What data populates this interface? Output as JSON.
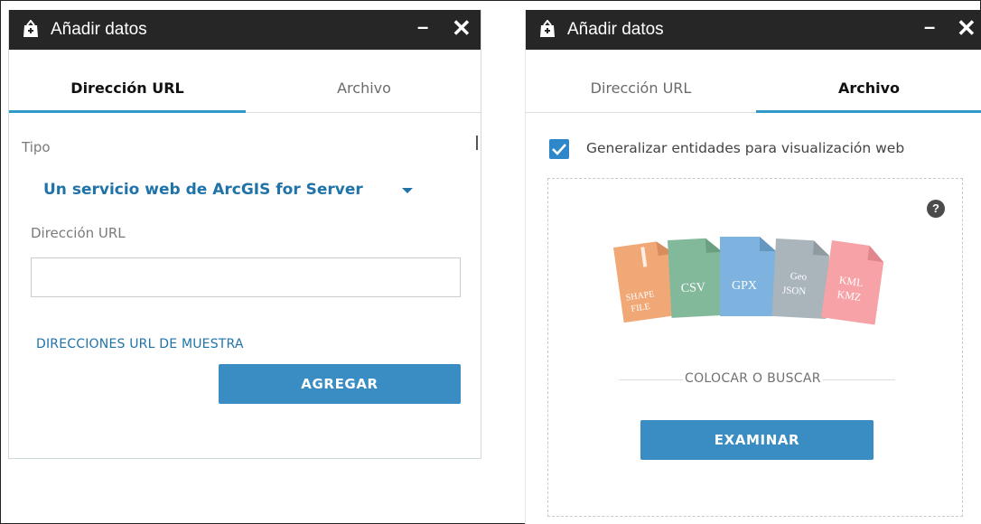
{
  "left_panel": {
    "title": "Añadir datos",
    "minimize_glyph": "–",
    "close_glyph": "✕",
    "tabs": [
      {
        "label": "Dirección URL",
        "active": true
      },
      {
        "label": "Archivo",
        "active": false
      }
    ],
    "type_label": "Tipo",
    "type_value": "Un servicio web de ArcGIS for Server",
    "url_label": "Dirección URL",
    "url_value": "",
    "sample_link": "DIRECCIONES URL DE MUESTRA",
    "add_button": "AGREGAR"
  },
  "right_panel": {
    "title": "Añadir datos",
    "minimize_glyph": "–",
    "close_glyph": "✕",
    "tabs": [
      {
        "label": "Dirección URL",
        "active": false
      },
      {
        "label": "Archivo",
        "active": true
      }
    ],
    "generalize_label": "Generalizar entidades para visualización web",
    "generalize_checked": true,
    "help_glyph": "?",
    "file_types": [
      {
        "lines": [
          "SHAPE",
          "FILE"
        ],
        "color": "#f0a877",
        "icon": "zipper-icon"
      },
      {
        "lines": [
          "CSV"
        ],
        "color": "#82b99a"
      },
      {
        "lines": [
          "GPX"
        ],
        "color": "#7db3de"
      },
      {
        "lines": [
          "Geo",
          "JSON"
        ],
        "color": "#a9b4bb"
      },
      {
        "lines": [
          "KML",
          "KMZ"
        ],
        "color": "#f7a2a7"
      }
    ],
    "drop_text": "COLOCAR O BUSCAR",
    "browse_button": "EXAMINAR"
  },
  "colors": {
    "titlebar": "#262626",
    "accent": "#2d9ac8",
    "link": "#1f73a8",
    "button": "#3a8dc3"
  },
  "icons": {
    "title_icon": "add-data-bag-icon",
    "check": "checkmark-icon",
    "help": "question-circle-icon"
  }
}
